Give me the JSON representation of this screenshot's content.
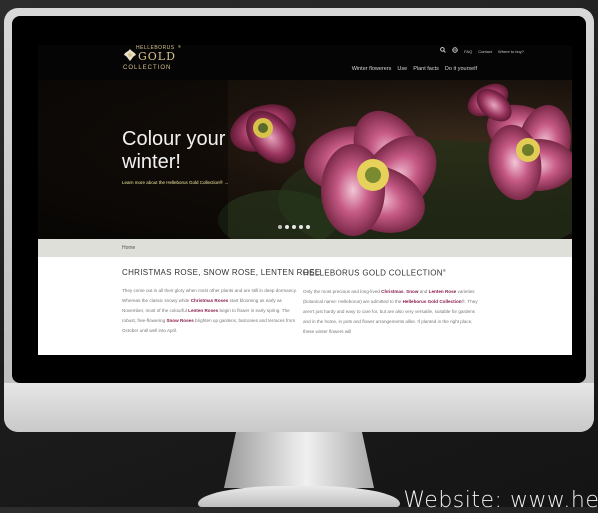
{
  "site": {
    "logo_top": "HELLEBORUS",
    "logo_main": "GOLD",
    "logo_bottom": "COLLECTION",
    "logo_reg": "®",
    "util": {
      "contact": "Contact",
      "faq": "FAQ",
      "where_to_buy": "Where to buy?"
    },
    "nav": [
      "Winter flowerers",
      "Use",
      "Plant facts",
      "Do it yourself"
    ],
    "hero": {
      "title": "Colour your winter!",
      "link": "Learn more about the Helleborus Gold Collection® →"
    },
    "breadcrumb": "Home",
    "col1": {
      "heading": "CHRISTMAS ROSE, SNOW ROSE, LENTEN ROSE",
      "p_parts": [
        "They come out in all their glory when most other plants and are still in deep dormancy. Whereas the classic snowy white ",
        "Christmas Roses",
        " start blooming as early as November, most of the colourful ",
        "Lenten Roses",
        " begin to flower in early spring. The robust, free-flowering ",
        "Snow Roses",
        " brighten up gardens, balconies and terraces from October until well into April."
      ]
    },
    "col2": {
      "heading": "HELLEBORUS GOLD COLLECTION",
      "heading_reg": "®",
      "p_parts": [
        "Only the most precious and long-lived ",
        "Christmas",
        ", ",
        "Snow",
        " and ",
        "Lenten Rose",
        " varieties (botanical name: Helleborus) are admitted to the ",
        "Helleborus Gold Collection",
        "®. They aren't just hardy and easy to care for, but are also very versatile, suitable for gardens and in the home, in pots and flower arrangements alike. If planted in the right place, these winter flowers will"
      ]
    }
  },
  "caption": "Website: www.hel",
  "slider": {
    "count": 5,
    "active": 0
  },
  "colors": {
    "accent": "#8a1d4c",
    "gold": "#d9c48d",
    "breadcrumb_bg": "#dedfd9"
  }
}
